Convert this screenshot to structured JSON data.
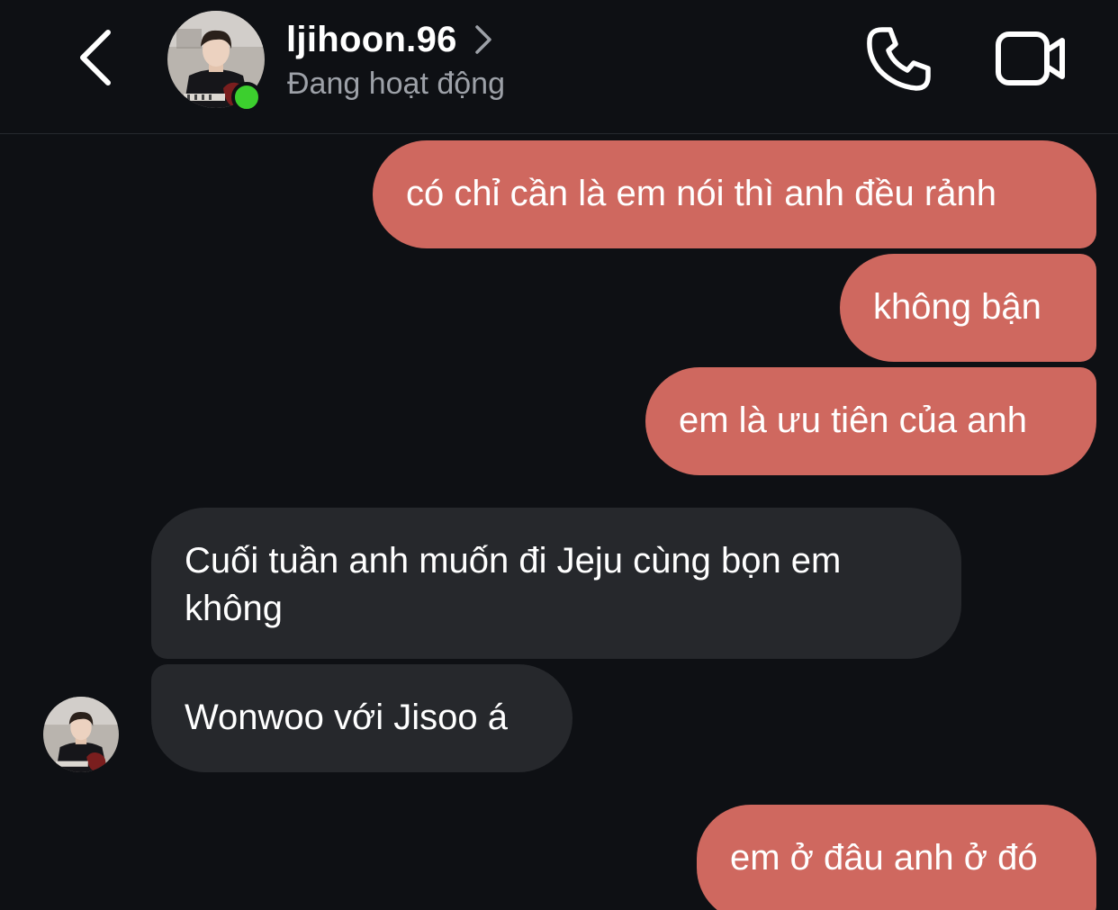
{
  "header": {
    "username": "ljihoon.96",
    "status": "Đang hoạt động"
  },
  "icons": {
    "back": "chevron-left-icon",
    "profile": "chevron-right-icon",
    "call": "phone-icon",
    "video": "video-camera-icon"
  },
  "colors": {
    "background": "#0e1014",
    "outgoing_bubble": "#cf685f",
    "incoming_bubble": "#26282c",
    "online": "#3ccf2e",
    "status_text": "#9da1a8"
  },
  "messages": [
    {
      "from": "me",
      "text": "có chỉ cần là em nói thì anh đều rảnh"
    },
    {
      "from": "me",
      "text": "không bận"
    },
    {
      "from": "me",
      "text": "em là ưu tiên của anh"
    },
    {
      "from": "them",
      "text": "Cuối tuần anh muốn đi Jeju cùng bọn em không"
    },
    {
      "from": "them",
      "text": "Wonwoo với Jisoo á"
    },
    {
      "from": "me",
      "text": "em ở đâu anh ở đó"
    }
  ]
}
